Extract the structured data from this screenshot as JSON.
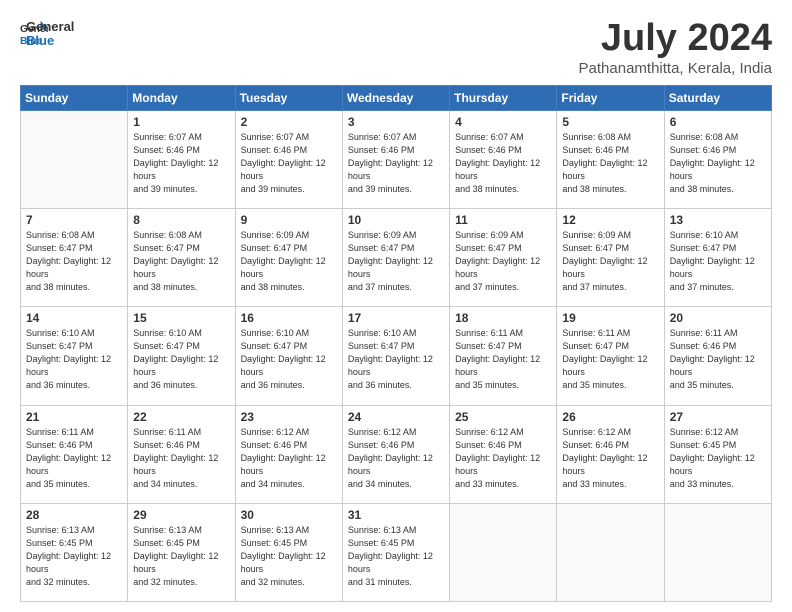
{
  "header": {
    "logo_general": "General",
    "logo_blue": "Blue",
    "month_title": "July 2024",
    "location": "Pathanamthitta, Kerala, India"
  },
  "days_of_week": [
    "Sunday",
    "Monday",
    "Tuesday",
    "Wednesday",
    "Thursday",
    "Friday",
    "Saturday"
  ],
  "weeks": [
    [
      {
        "day": "",
        "sunrise": "",
        "sunset": "",
        "daylight": "",
        "empty": true
      },
      {
        "day": "1",
        "sunrise": "Sunrise: 6:07 AM",
        "sunset": "Sunset: 6:46 PM",
        "daylight": "Daylight: 12 hours and 39 minutes."
      },
      {
        "day": "2",
        "sunrise": "Sunrise: 6:07 AM",
        "sunset": "Sunset: 6:46 PM",
        "daylight": "Daylight: 12 hours and 39 minutes."
      },
      {
        "day": "3",
        "sunrise": "Sunrise: 6:07 AM",
        "sunset": "Sunset: 6:46 PM",
        "daylight": "Daylight: 12 hours and 39 minutes."
      },
      {
        "day": "4",
        "sunrise": "Sunrise: 6:07 AM",
        "sunset": "Sunset: 6:46 PM",
        "daylight": "Daylight: 12 hours and 38 minutes."
      },
      {
        "day": "5",
        "sunrise": "Sunrise: 6:08 AM",
        "sunset": "Sunset: 6:46 PM",
        "daylight": "Daylight: 12 hours and 38 minutes."
      },
      {
        "day": "6",
        "sunrise": "Sunrise: 6:08 AM",
        "sunset": "Sunset: 6:46 PM",
        "daylight": "Daylight: 12 hours and 38 minutes."
      }
    ],
    [
      {
        "day": "7",
        "sunrise": "Sunrise: 6:08 AM",
        "sunset": "Sunset: 6:47 PM",
        "daylight": "Daylight: 12 hours and 38 minutes."
      },
      {
        "day": "8",
        "sunrise": "Sunrise: 6:08 AM",
        "sunset": "Sunset: 6:47 PM",
        "daylight": "Daylight: 12 hours and 38 minutes."
      },
      {
        "day": "9",
        "sunrise": "Sunrise: 6:09 AM",
        "sunset": "Sunset: 6:47 PM",
        "daylight": "Daylight: 12 hours and 38 minutes."
      },
      {
        "day": "10",
        "sunrise": "Sunrise: 6:09 AM",
        "sunset": "Sunset: 6:47 PM",
        "daylight": "Daylight: 12 hours and 37 minutes."
      },
      {
        "day": "11",
        "sunrise": "Sunrise: 6:09 AM",
        "sunset": "Sunset: 6:47 PM",
        "daylight": "Daylight: 12 hours and 37 minutes."
      },
      {
        "day": "12",
        "sunrise": "Sunrise: 6:09 AM",
        "sunset": "Sunset: 6:47 PM",
        "daylight": "Daylight: 12 hours and 37 minutes."
      },
      {
        "day": "13",
        "sunrise": "Sunrise: 6:10 AM",
        "sunset": "Sunset: 6:47 PM",
        "daylight": "Daylight: 12 hours and 37 minutes."
      }
    ],
    [
      {
        "day": "14",
        "sunrise": "Sunrise: 6:10 AM",
        "sunset": "Sunset: 6:47 PM",
        "daylight": "Daylight: 12 hours and 36 minutes."
      },
      {
        "day": "15",
        "sunrise": "Sunrise: 6:10 AM",
        "sunset": "Sunset: 6:47 PM",
        "daylight": "Daylight: 12 hours and 36 minutes."
      },
      {
        "day": "16",
        "sunrise": "Sunrise: 6:10 AM",
        "sunset": "Sunset: 6:47 PM",
        "daylight": "Daylight: 12 hours and 36 minutes."
      },
      {
        "day": "17",
        "sunrise": "Sunrise: 6:10 AM",
        "sunset": "Sunset: 6:47 PM",
        "daylight": "Daylight: 12 hours and 36 minutes."
      },
      {
        "day": "18",
        "sunrise": "Sunrise: 6:11 AM",
        "sunset": "Sunset: 6:47 PM",
        "daylight": "Daylight: 12 hours and 35 minutes."
      },
      {
        "day": "19",
        "sunrise": "Sunrise: 6:11 AM",
        "sunset": "Sunset: 6:47 PM",
        "daylight": "Daylight: 12 hours and 35 minutes."
      },
      {
        "day": "20",
        "sunrise": "Sunrise: 6:11 AM",
        "sunset": "Sunset: 6:46 PM",
        "daylight": "Daylight: 12 hours and 35 minutes."
      }
    ],
    [
      {
        "day": "21",
        "sunrise": "Sunrise: 6:11 AM",
        "sunset": "Sunset: 6:46 PM",
        "daylight": "Daylight: 12 hours and 35 minutes."
      },
      {
        "day": "22",
        "sunrise": "Sunrise: 6:11 AM",
        "sunset": "Sunset: 6:46 PM",
        "daylight": "Daylight: 12 hours and 34 minutes."
      },
      {
        "day": "23",
        "sunrise": "Sunrise: 6:12 AM",
        "sunset": "Sunset: 6:46 PM",
        "daylight": "Daylight: 12 hours and 34 minutes."
      },
      {
        "day": "24",
        "sunrise": "Sunrise: 6:12 AM",
        "sunset": "Sunset: 6:46 PM",
        "daylight": "Daylight: 12 hours and 34 minutes."
      },
      {
        "day": "25",
        "sunrise": "Sunrise: 6:12 AM",
        "sunset": "Sunset: 6:46 PM",
        "daylight": "Daylight: 12 hours and 33 minutes."
      },
      {
        "day": "26",
        "sunrise": "Sunrise: 6:12 AM",
        "sunset": "Sunset: 6:46 PM",
        "daylight": "Daylight: 12 hours and 33 minutes."
      },
      {
        "day": "27",
        "sunrise": "Sunrise: 6:12 AM",
        "sunset": "Sunset: 6:45 PM",
        "daylight": "Daylight: 12 hours and 33 minutes."
      }
    ],
    [
      {
        "day": "28",
        "sunrise": "Sunrise: 6:13 AM",
        "sunset": "Sunset: 6:45 PM",
        "daylight": "Daylight: 12 hours and 32 minutes."
      },
      {
        "day": "29",
        "sunrise": "Sunrise: 6:13 AM",
        "sunset": "Sunset: 6:45 PM",
        "daylight": "Daylight: 12 hours and 32 minutes."
      },
      {
        "day": "30",
        "sunrise": "Sunrise: 6:13 AM",
        "sunset": "Sunset: 6:45 PM",
        "daylight": "Daylight: 12 hours and 32 minutes."
      },
      {
        "day": "31",
        "sunrise": "Sunrise: 6:13 AM",
        "sunset": "Sunset: 6:45 PM",
        "daylight": "Daylight: 12 hours and 31 minutes."
      },
      {
        "day": "",
        "sunrise": "",
        "sunset": "",
        "daylight": "",
        "empty": true
      },
      {
        "day": "",
        "sunrise": "",
        "sunset": "",
        "daylight": "",
        "empty": true
      },
      {
        "day": "",
        "sunrise": "",
        "sunset": "",
        "daylight": "",
        "empty": true
      }
    ]
  ]
}
